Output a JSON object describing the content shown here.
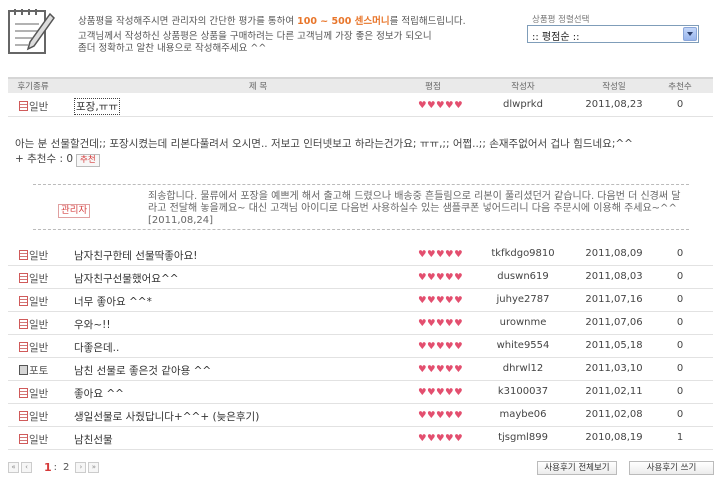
{
  "intro": {
    "line1_pre": "상품평을 작성해주시면 관리자의 간단한 평가를 통하여 ",
    "line1_points": "100 ~ 500 센스머니",
    "line1_post": "를 적립해드립니다.",
    "line2": "고객님께서 작성하신 상품평은 상품을 구매하려는 다른 고객님께 가장 좋은 정보가 되오니",
    "line3": "좀더 정확하고 알찬 내용으로 작성해주세요 ^^"
  },
  "sort": {
    "label": "상품평 정렬선택",
    "selected": ":: 평점순 ::"
  },
  "table_headers": {
    "type": "후기종류",
    "title": "제 목",
    "rating": "평점",
    "author": "작성자",
    "date": "작성일",
    "recommend": "추천수"
  },
  "rows": [
    {
      "type": "일반",
      "title": "포장,ㅠㅠ",
      "stars": "♥♥♥♥♥",
      "author": "dlwprkd",
      "date": "2011,08,23",
      "rec": "0"
    },
    {
      "type": "일반",
      "title": "남자친구한테 선물딱좋아요!",
      "stars": "♥♥♥♥♥",
      "author": "tkfkdgo9810",
      "date": "2011,08,09",
      "rec": "0"
    },
    {
      "type": "일반",
      "title": "남자친구선물했어요^^",
      "stars": "♥♥♥♥♥",
      "author": "duswn619",
      "date": "2011,08,03",
      "rec": "0"
    },
    {
      "type": "일반",
      "title": "너무 좋아요 ^^*",
      "stars": "♥♥♥♥♥",
      "author": "juhye2787",
      "date": "2011,07,16",
      "rec": "0"
    },
    {
      "type": "일반",
      "title": "우와~!!",
      "stars": "♥♥♥♥♥",
      "author": "urownme",
      "date": "2011,07,06",
      "rec": "0"
    },
    {
      "type": "일반",
      "title": "다좋은데..",
      "stars": "♥♥♥♥♥",
      "author": "white9554",
      "date": "2011,05,18",
      "rec": "0"
    },
    {
      "type": "포토",
      "title": "남친 선물로 좋은것 같아용 ^^",
      "stars": "♥♥♥♥♥",
      "author": "dhrwl12",
      "date": "2011,03,10",
      "rec": "0"
    },
    {
      "type": "일반",
      "title": "좋아요 ^^",
      "stars": "♥♥♥♥♥",
      "author": "k3100037",
      "date": "2011,02,11",
      "rec": "0"
    },
    {
      "type": "일반",
      "title": "생일선물로 사줬답니다+^^+ (늦은후기)",
      "stars": "♥♥♥♥♥",
      "author": "maybe06",
      "date": "2011,02,08",
      "rec": "0"
    },
    {
      "type": "일반",
      "title": "남친선물",
      "stars": "♥♥♥♥♥",
      "author": "tjsgml899",
      "date": "2010,08,19",
      "rec": "1"
    }
  ],
  "expanded": {
    "body": "아는 분 선물할건데;; 포장시켰는데 리본다풀려서 오시면.. 저보고 인터넷보고 하라는건가요; ㅠㅠ,;; 어쩝..;; 손재주없어서 겁나 힘드네요;^^",
    "rec_label": "+ 추천수 : 0",
    "rec_button": "추천",
    "admin_tag": "관리자",
    "admin_reply": "죄송합니다. 물류에서 포장을 예쁘게 해서 출고해 드렸으나 배송중 흔들림으로 리본이 풀리셨던거 같습니다. 다음번 더 신경써 달라고 전달해 놓을께요~ 대신 고객님 아이디로 다음번 사용하실수 있는 샘플쿠폰 넣어드리니 다음 주문시에 이용해 주세요~^^ [2011,08,24]"
  },
  "pager": {
    "first": "«",
    "prev": "‹",
    "current": "1",
    "sep": ":",
    "page2": "2",
    "next": "›",
    "last": "»"
  },
  "buttons": {
    "view_all": "사용후기 전체보기",
    "write": "사용후기 쓰기"
  }
}
